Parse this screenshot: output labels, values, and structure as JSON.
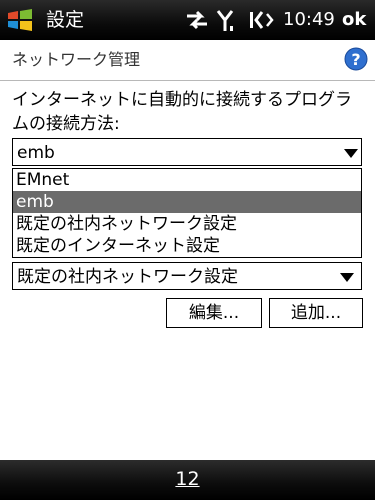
{
  "status_bar": {
    "app_title": "設定",
    "clock": "10:49",
    "ok_label": "ok",
    "icons": [
      "windows-start-icon",
      "data-connection-icon",
      "signal-strength-icon",
      "speaker-volume-icon"
    ]
  },
  "header": {
    "title": "ネットワーク管理",
    "help_icon": "help-icon"
  },
  "prompt": "インターネットに自動的に接続するプログラムの接続方法:",
  "combo_primary": {
    "value": "emb",
    "options": [
      "EMnet",
      "emb",
      "既定の社内ネットワーク設定",
      "既定のインターネット設定"
    ],
    "selected_index": 1
  },
  "combo_secondary": {
    "value": "既定の社内ネットワーク設定"
  },
  "buttons": {
    "edit": "編集...",
    "add": "追加..."
  },
  "softkey": {
    "label": "12"
  },
  "colors": {
    "bar_background": "#000000",
    "help_blue": "#2f6fcf",
    "selected_option": "#6b6b6b"
  }
}
